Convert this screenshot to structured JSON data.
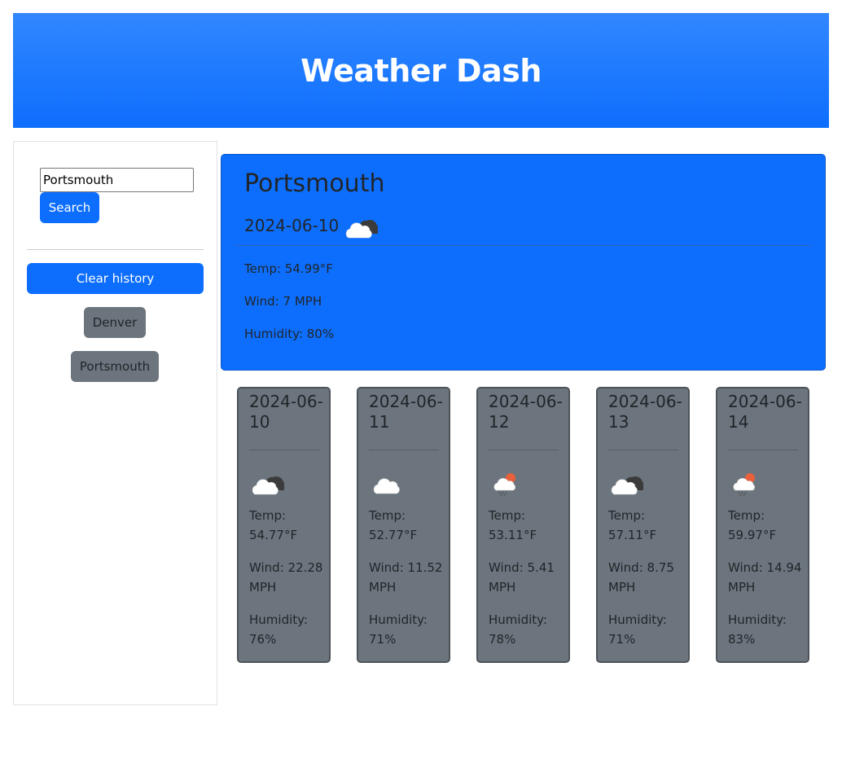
{
  "header": {
    "title": "Weather Dash"
  },
  "search": {
    "value": "Portsmouth",
    "button_label": "Search"
  },
  "history": {
    "clear_label": "Clear history",
    "items": [
      "Denver",
      "Portsmouth"
    ]
  },
  "current": {
    "city": "Portsmouth",
    "date": "2024-06-10",
    "icon": "broken-clouds-icon",
    "temp": "Temp: 54.99°F",
    "wind": "Wind: 7 MPH",
    "humidity": "Humidity: 80%"
  },
  "forecast": [
    {
      "date": "2024-06-10",
      "icon": "broken-clouds-icon",
      "temp": "Temp: 54.77°F",
      "wind": "Wind: 22.28 MPH",
      "humidity": "Humidity: 76%"
    },
    {
      "date": "2024-06-11",
      "icon": "cloud-icon",
      "temp": "Temp: 52.77°F",
      "wind": "Wind: 11.52 MPH",
      "humidity": "Humidity: 71%"
    },
    {
      "date": "2024-06-12",
      "icon": "sun-rain-icon",
      "temp": "Temp: 53.11°F",
      "wind": "Wind: 5.41 MPH",
      "humidity": "Humidity: 78%"
    },
    {
      "date": "2024-06-13",
      "icon": "broken-clouds-icon",
      "temp": "Temp: 57.11°F",
      "wind": "Wind: 8.75 MPH",
      "humidity": "Humidity: 71%"
    },
    {
      "date": "2024-06-14",
      "icon": "sun-rain-icon",
      "temp": "Temp: 59.97°F",
      "wind": "Wind: 14.94 MPH",
      "humidity": "Humidity: 83%"
    }
  ],
  "colors": {
    "primary": "#0d6efd",
    "secondary": "#6c757d"
  }
}
